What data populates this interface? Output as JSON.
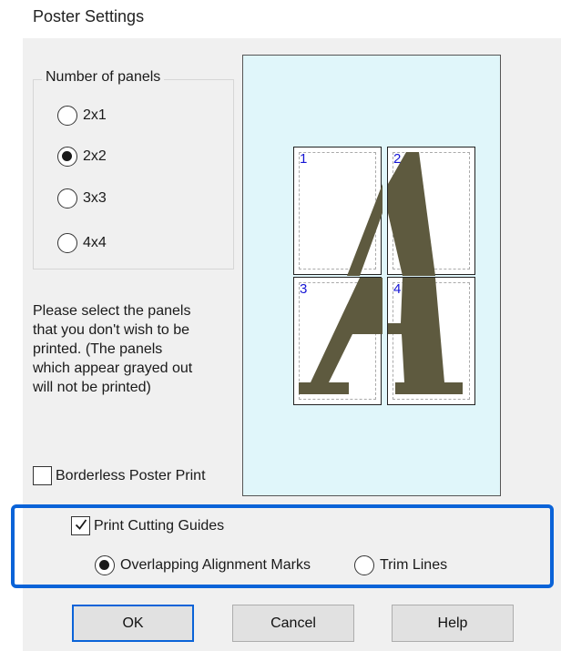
{
  "window": {
    "title": "Poster Settings"
  },
  "panels_group": {
    "label": "Number of panels",
    "options": [
      {
        "label": "2x1",
        "selected": false
      },
      {
        "label": "2x2",
        "selected": true
      },
      {
        "label": "3x3",
        "selected": false
      },
      {
        "label": "4x4",
        "selected": false
      }
    ]
  },
  "instructions": "Please select the panels\nthat you don't wish to be\nprinted. (The panels\nwhich appear grayed out\nwill not be printed)",
  "borderless": {
    "label": "Borderless Poster Print",
    "checked": false
  },
  "preview": {
    "background_color": "#e0f6fa",
    "glyph_color": "#5e5a3f",
    "number_color": "#1515d4",
    "panels": [
      {
        "number": "1"
      },
      {
        "number": "2"
      },
      {
        "number": "3"
      },
      {
        "number": "4"
      }
    ]
  },
  "cutting_guides": {
    "label": "Print Cutting Guides",
    "checked": true,
    "options": [
      {
        "label": "Overlapping Alignment Marks",
        "selected": true
      },
      {
        "label": "Trim Lines",
        "selected": false
      }
    ],
    "highlight_color": "#0a63d8"
  },
  "buttons": {
    "ok": "OK",
    "cancel": "Cancel",
    "help": "Help"
  }
}
